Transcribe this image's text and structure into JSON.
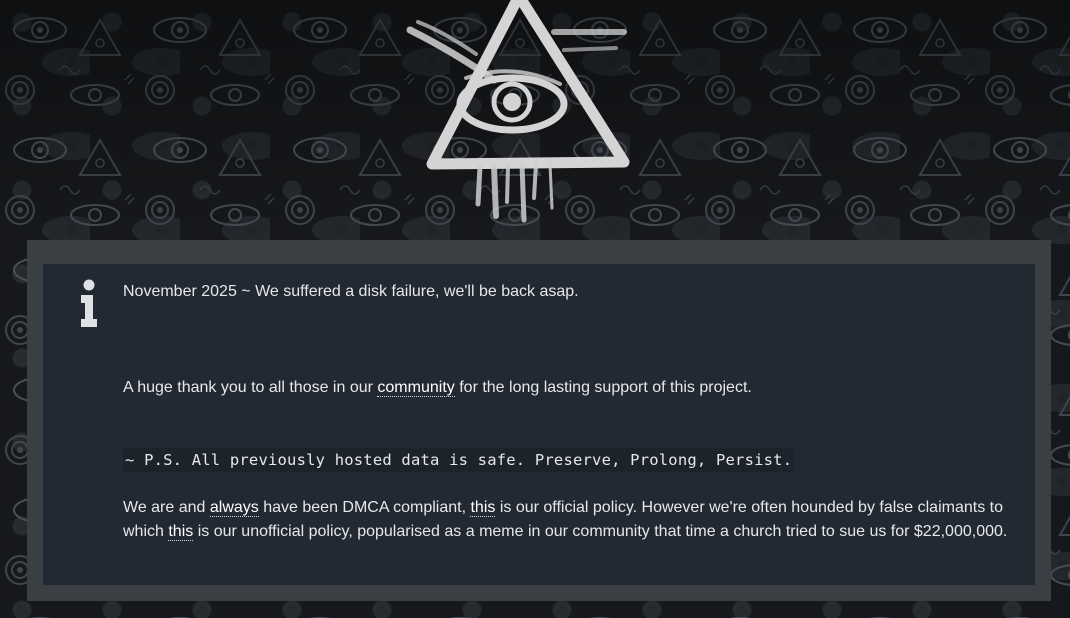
{
  "notice": {
    "headline": "November 2025 ~ We suffered a disk failure, we'll be back asap.",
    "thanks_prefix": "A huge thank you to all those in our",
    "thanks_link": "community",
    "thanks_suffix": "for the long lasting support of this project.",
    "ps": "~ P.S. All previously hosted data is safe. Preserve, Prolong, Persist.",
    "dmca_part1": "We are and",
    "dmca_link_always": "always",
    "dmca_part2": "have been DMCA compliant,",
    "dmca_link_this1": "this",
    "dmca_part3": "is our official policy. However we're often hounded by false claimants to which",
    "dmca_link_this2": "this",
    "dmca_part4": "is our unofficial policy, popularised as a meme in our community that time a church tried to sue us for $22,000,000."
  },
  "icons": {
    "logo": "all-seeing-eye-triangle-logo",
    "info": "info-icon"
  },
  "colors": {
    "background": "#16181b",
    "outer_panel": "#3a3f44",
    "notice_panel": "#222933",
    "text": "#e6e8ea",
    "link": "#ffffff"
  }
}
